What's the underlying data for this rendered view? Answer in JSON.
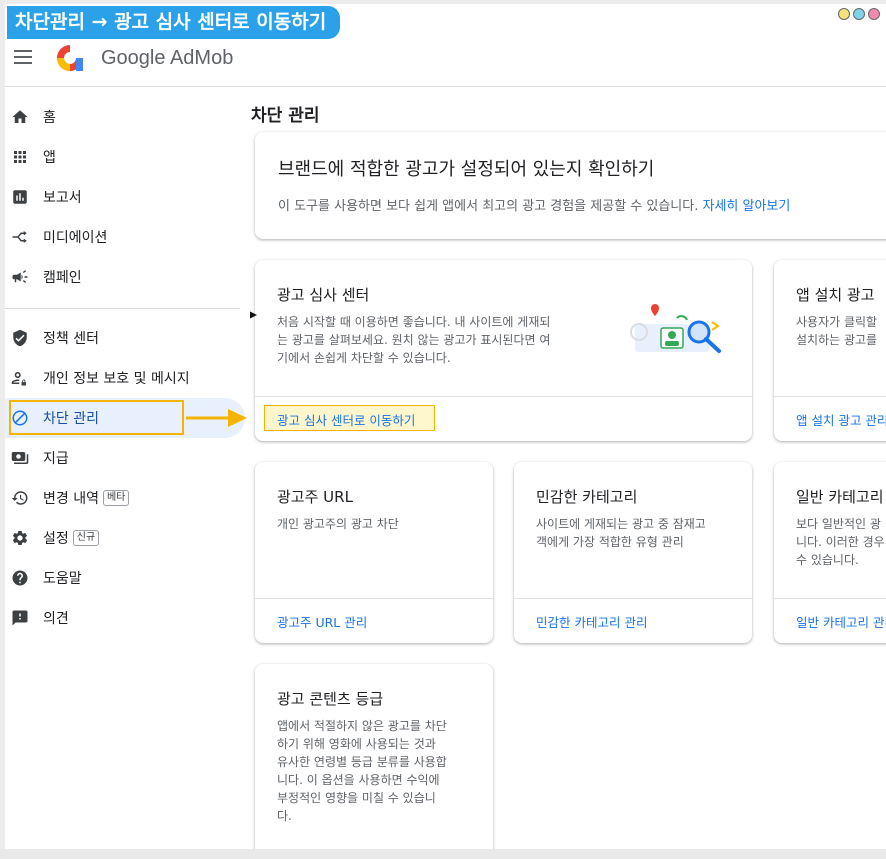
{
  "banner": "차단관리 → 광고 심사 센터로 이동하기",
  "app": {
    "title": "Google AdMob"
  },
  "sidebar": {
    "items": [
      {
        "label": "홈",
        "icon": "home-icon"
      },
      {
        "label": "앱",
        "icon": "apps-grid-icon"
      },
      {
        "label": "보고서",
        "icon": "reports-icon"
      },
      {
        "label": "미디에이션",
        "icon": "mediation-icon"
      },
      {
        "label": "캠페인",
        "icon": "megaphone-icon"
      },
      {
        "label": "정책 센터",
        "icon": "shield-icon"
      },
      {
        "label": "개인 정보 보호 및 메시지",
        "icon": "privacy-person-icon"
      },
      {
        "label": "차단 관리",
        "icon": "block-icon"
      },
      {
        "label": "지급",
        "icon": "payments-icon"
      },
      {
        "label": "변경 내역",
        "icon": "history-icon",
        "badge": "베타"
      },
      {
        "label": "설정",
        "icon": "gear-icon",
        "badge": "신규"
      },
      {
        "label": "도움말",
        "icon": "help-icon"
      },
      {
        "label": "의견",
        "icon": "feedback-icon"
      }
    ]
  },
  "main": {
    "page_title": "차단 관리",
    "hero": {
      "title": "브랜드에 적합한 광고가 설정되어 있는지 확인하기",
      "desc": "이 도구를 사용하면 보다 쉽게 앱에서 최고의 광고 경험을 제공할 수 있습니다.",
      "link": "자세히 알아보기"
    },
    "cards": [
      {
        "title": "광고 심사 센터",
        "desc1": "처음 시작할 때 이용하면 좋습니다. 내 사이트에 게재되",
        "desc2": "는 광고를 살펴보세요. 원치 않는 광고가 표시된다면 여",
        "desc3": "기에서 손쉽게 차단할 수 있습니다.",
        "link": "광고 심사 센터로 이동하기"
      },
      {
        "title": "앱 설치 광고",
        "desc1": "사용자가 클릭할",
        "desc2": "설치하는 광고를",
        "link": "앱 설치 광고 관리"
      },
      {
        "title": "광고주 URL",
        "desc1": "개인 광고주의 광고 차단",
        "link": "광고주 URL 관리"
      },
      {
        "title": "민감한 카테고리",
        "desc1": "사이트에 게재되는 광고 중 잠재고",
        "desc2": "객에게 가장 적합한 유형 관리",
        "link": "민감한 카테고리 관리"
      },
      {
        "title": "일반 카테고리",
        "desc1": "보다 일반적인 광",
        "desc2": "니다. 이러한 경우",
        "desc3": "수 있습니다.",
        "link": "일반 카테고리 관리"
      },
      {
        "title": "광고 콘텐츠 등급",
        "desc1": "앱에서 적절하지 않은 광고를 차단",
        "desc2": "하기 위해 영화에 사용되는 것과",
        "desc3": "유사한 연령별 등급 분류를 사용합",
        "desc4": "니다. 이 옵션을 사용하면 수익에",
        "desc5": "부정적인 영향을 미칠 수 있습니",
        "desc6": "다."
      }
    ]
  },
  "colors": {
    "accent": "#1a73e8",
    "banner": "#2aa1e8",
    "highlight": "#f4b400"
  }
}
